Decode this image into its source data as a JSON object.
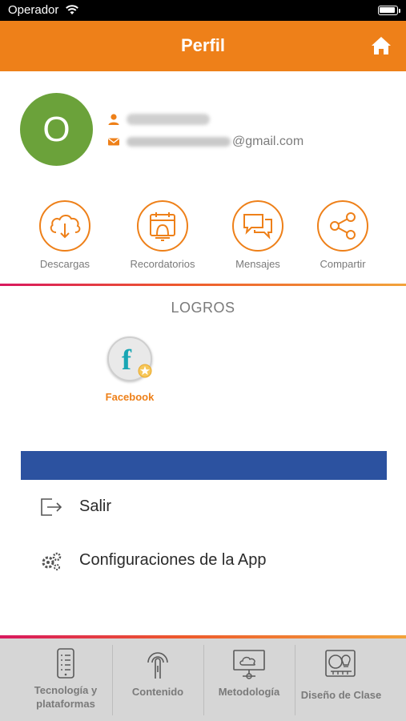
{
  "status_bar": {
    "carrier": "Operador"
  },
  "header": {
    "title": "Perfil"
  },
  "profile": {
    "avatar_letter": "O",
    "email_suffix": "@gmail.com"
  },
  "actions": [
    {
      "label": "Descargas",
      "icon": "cloud-download-icon"
    },
    {
      "label": "Recordatorios",
      "icon": "calendar-bell-icon"
    },
    {
      "label": "Mensajes",
      "icon": "chat-bubbles-icon"
    },
    {
      "label": "Compartir",
      "icon": "share-icon"
    }
  ],
  "logros": {
    "title": "LOGROS",
    "badges": [
      {
        "label": "Facebook",
        "icon": "facebook-badge-icon"
      }
    ]
  },
  "menu": [
    {
      "label": "Salir",
      "icon": "logout-icon"
    },
    {
      "label": "Configuraciones de la App",
      "icon": "gears-icon"
    }
  ],
  "bottom_nav": [
    {
      "line1": "Tecnología y",
      "line2": "plataformas",
      "icon": "phone-checklist-icon"
    },
    {
      "line1": "Contenido",
      "line2": "",
      "icon": "touch-content-icon"
    },
    {
      "line1": "Metodología",
      "line2": "",
      "icon": "monitor-cloud-icon"
    },
    {
      "line1": "Diseño de Clase",
      "line2": "",
      "icon": "idea-board-icon"
    }
  ],
  "colors": {
    "accent": "#ee8019",
    "avatar": "#6ba23a",
    "blue_bar": "#2c52a0",
    "badge_f": "#18a6b4"
  }
}
